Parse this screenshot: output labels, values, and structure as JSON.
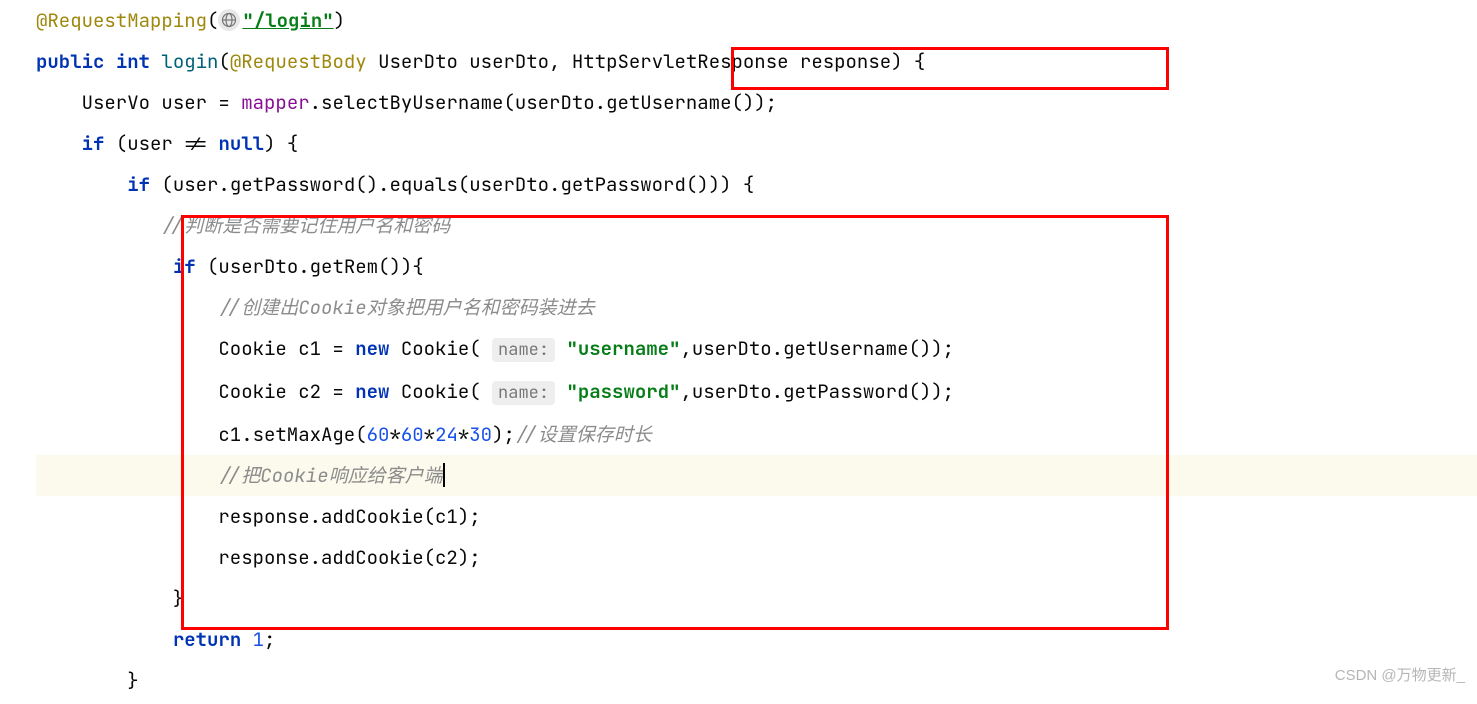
{
  "code": {
    "annotation_request_mapping": "@RequestMapping",
    "annotation_request_body": "@RequestBody",
    "mapping_path": "\"/login\"",
    "kw_public": "public",
    "kw_int": "int",
    "method_login": "login",
    "type_userdto": "UserDto",
    "param_userdto": "userDto",
    "type_httpresponse": "HttpServletResponse",
    "param_response": "response",
    "type_uservo": "UserVo",
    "var_user": "user",
    "field_mapper": "mapper",
    "method_selectByUsername": "selectByUsername",
    "method_getUsername": "getUsername",
    "kw_if": "if",
    "kw_null": "null",
    "kw_return": "return",
    "kw_new": "new",
    "method_getPassword": "getPassword",
    "method_equals": "equals",
    "comment_ifrem": "//判断是否需要记住用户名和密码",
    "method_getRem": "getRem",
    "comment_create_cookie": "//创建出Cookie对象把用户名和密码装进去",
    "type_cookie": "Cookie",
    "var_c1": "c1",
    "var_c2": "c2",
    "hint_name": "name:",
    "str_username": "\"username\"",
    "str_password": "\"password\"",
    "method_setMaxAge": "setMaxAge",
    "num_60a": "60",
    "num_60b": "60",
    "num_24": "24",
    "num_30": "30",
    "comment_maxage": "//设置保存时长",
    "comment_response_cookie": "//把Cookie响应给客户端",
    "method_addCookie": "addCookie",
    "return_val": "1"
  },
  "watermark": "CSDN @万物更新_"
}
